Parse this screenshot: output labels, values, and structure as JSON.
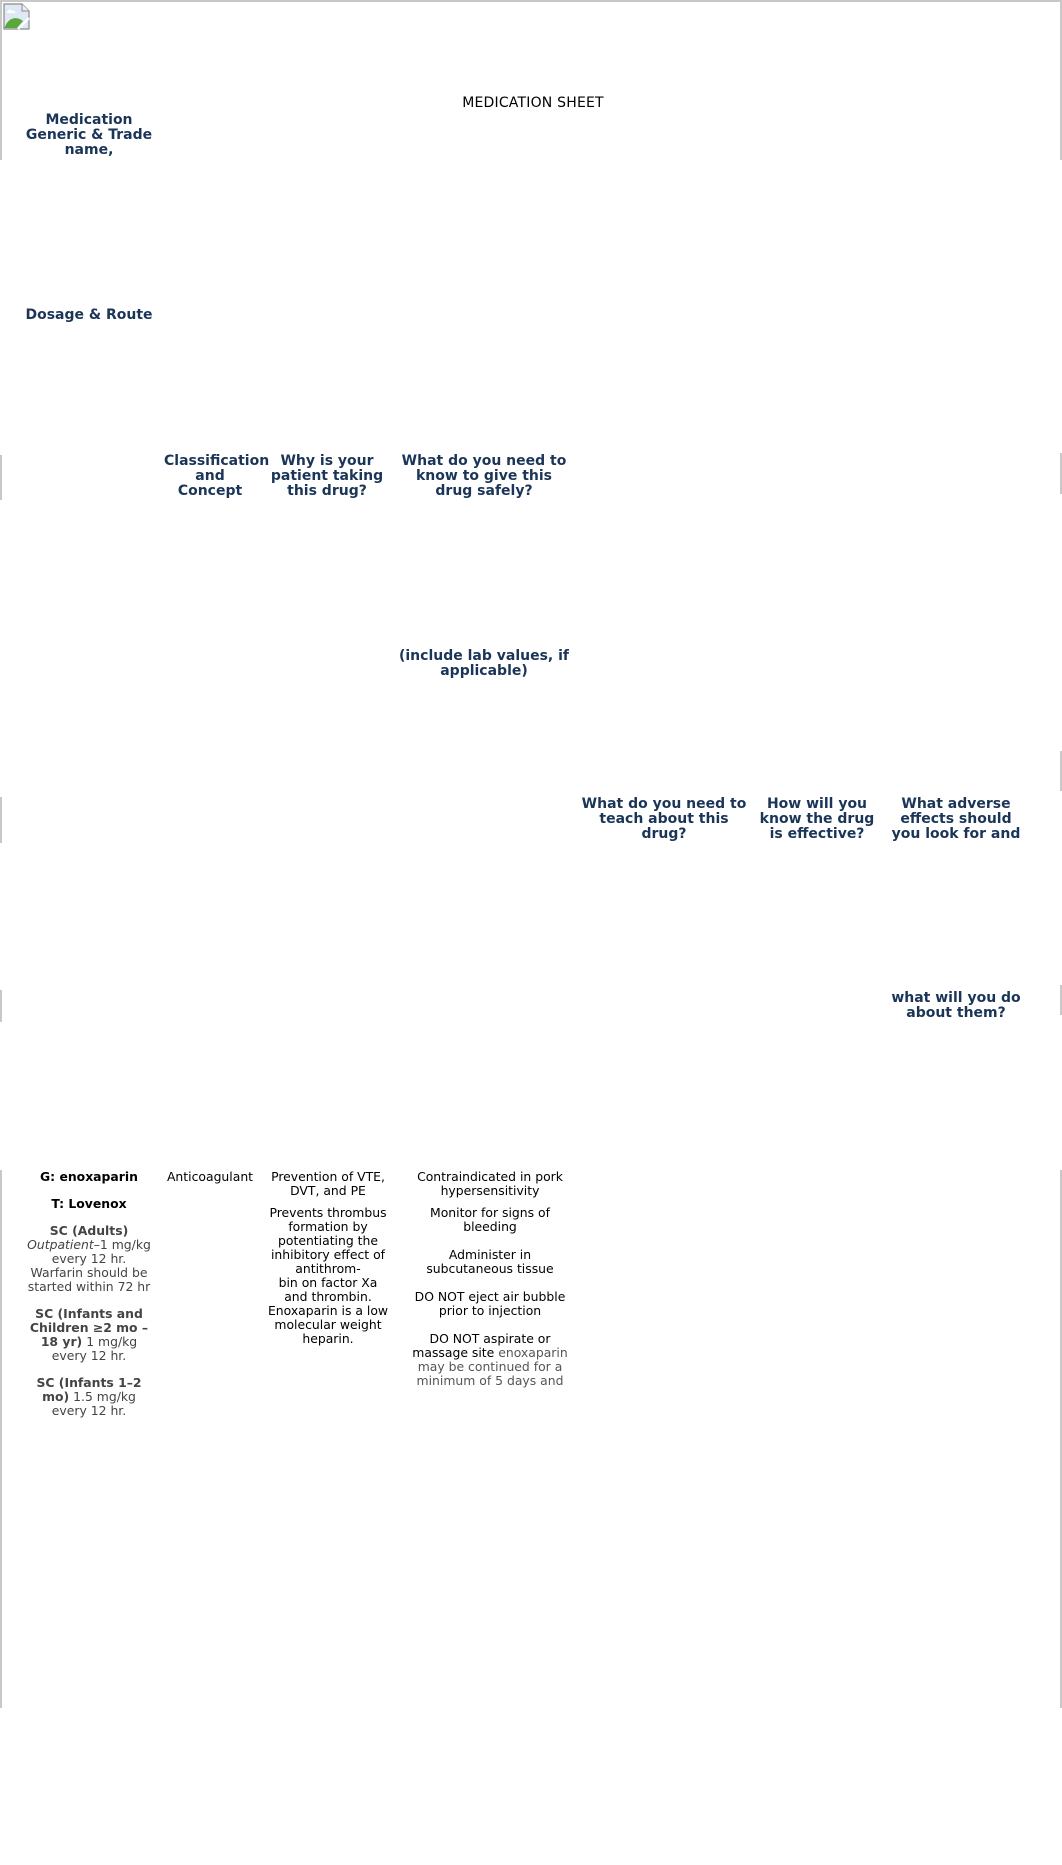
{
  "document": {
    "title": "MEDICATION SHEET",
    "image_alt": "broken-image"
  },
  "headers": {
    "medication_name": "Medication Generic & Trade name,",
    "dosage_route": "Dosage & Route",
    "classification": "Classification and Concept",
    "why_taking": "Why is your patient taking this drug?",
    "give_safely": "What do you need to know to give this drug safely?",
    "give_safely_note": "(include lab values, if applicable)",
    "teach": "What do you need to teach about this drug?",
    "effective": "How will you know the drug is effective?",
    "adverse": "What adverse effects should you look for and",
    "adverse_cont": "what will you do about them?"
  },
  "row": {
    "generic": "G: enoxaparin",
    "trade": "T: Lovenox",
    "dosage": [
      {
        "label": "SC (Adults)",
        "italic": "Outpatient",
        "text": "–1 mg/kg every 12 hr. Warfarin should be started within 72 hr"
      },
      {
        "label": "SC (Infants and Children ≥2 mo – 18 yr)",
        "text": "1 mg/kg every 12 hr."
      },
      {
        "label": "SC (Infants 1–2 mo)",
        "text": "1.5 mg/kg every 12 hr."
      }
    ],
    "classification": "Anticoagulant",
    "why": [
      "Prevention of VTE, DVT, and PE",
      "Prevents thrombus formation by potentiating the inhibitory effect of antithrom-",
      "bin on factor Xa and thrombin.",
      "Enoxaparin is a low molecular weight heparin."
    ],
    "safety": [
      "Contraindicated in pork hypersensitivity",
      "Monitor for signs of bleeding",
      "Administer in subcutaneous tissue",
      "DO NOT eject air bubble prior to injection",
      "DO NOT aspirate or massage site"
    ],
    "safety_trailing": "enoxaparin may be continued for a minimum of 5 days and"
  }
}
